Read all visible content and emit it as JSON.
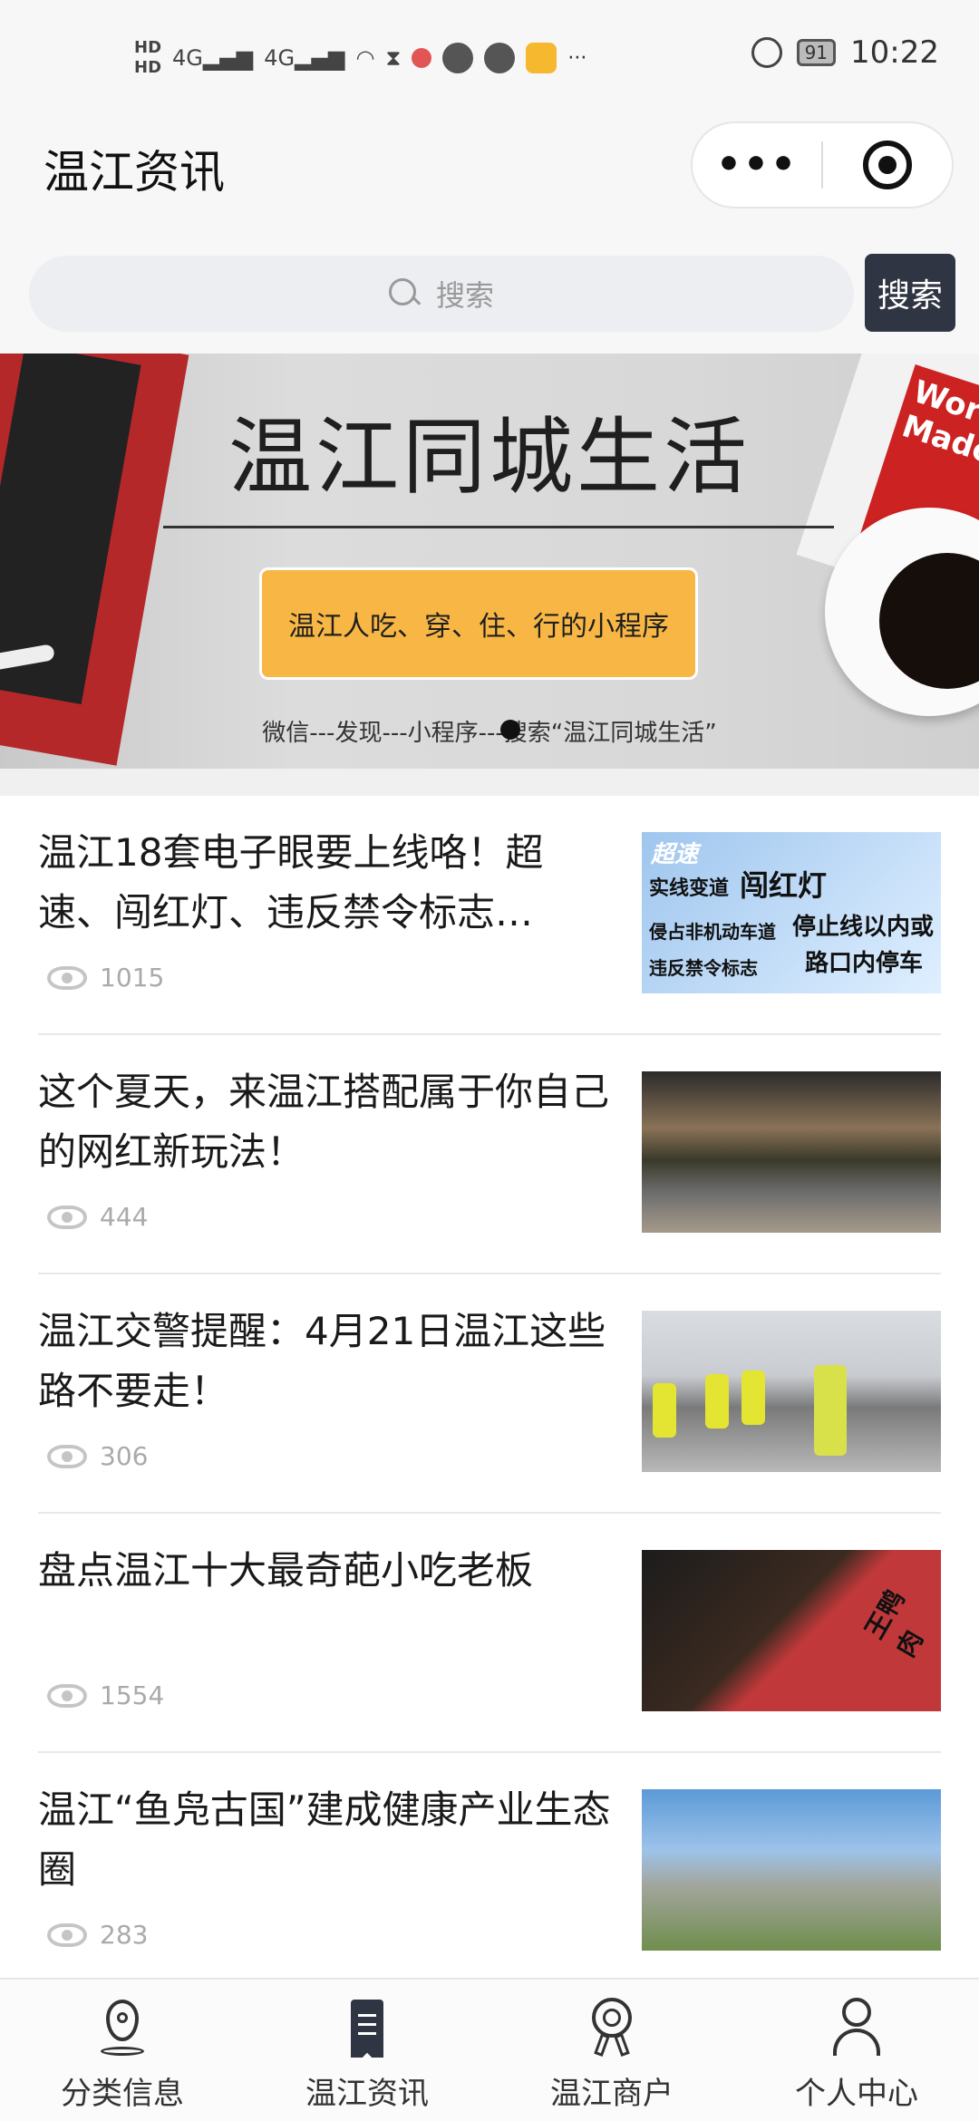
{
  "status_bar": {
    "hd1": "HD",
    "hd2": "HD",
    "net1": "4G",
    "net2": "4G",
    "more": "···",
    "battery": "91",
    "time": "10:22"
  },
  "header": {
    "title": "温江资讯",
    "more_label": "•••"
  },
  "search": {
    "placeholder": "搜索",
    "button_label": "搜索"
  },
  "banner": {
    "title": "温江同城生活",
    "slogan": "温江人吃、穿、住、行的小程序",
    "subtitle": "微信---发现---小程序---搜索“温江同城生活”",
    "book_text": "WordPo Made"
  },
  "articles": [
    {
      "title": "温江18套电子眼要上线咯！超速、闯红灯、违反禁令标志…",
      "views": "1015",
      "thumb_text": [
        "超速",
        "实线变道",
        "闯红灯",
        "侵占非机动车道",
        "停止线以内或",
        "违反禁令标志",
        "路口内停车"
      ]
    },
    {
      "title": "这个夏天，来温江搭配属于你自己的网红新玩法！",
      "views": "444"
    },
    {
      "title": "温江交警提醒：4月21日温江这些路不要走！",
      "views": "306"
    },
    {
      "title": "盘点温江十大最奇葩小吃老板",
      "views": "1554",
      "thumb_text": [
        "王鸭肉"
      ]
    },
    {
      "title": "温江“鱼凫古国”建成健康产业生态圈",
      "views": "283"
    }
  ],
  "tabs": [
    {
      "label": "分类信息",
      "icon": "location-pin-icon"
    },
    {
      "label": "温江资讯",
      "icon": "article-icon"
    },
    {
      "label": "温江商户",
      "icon": "merchant-badge-icon"
    },
    {
      "label": "个人中心",
      "icon": "user-icon"
    }
  ]
}
